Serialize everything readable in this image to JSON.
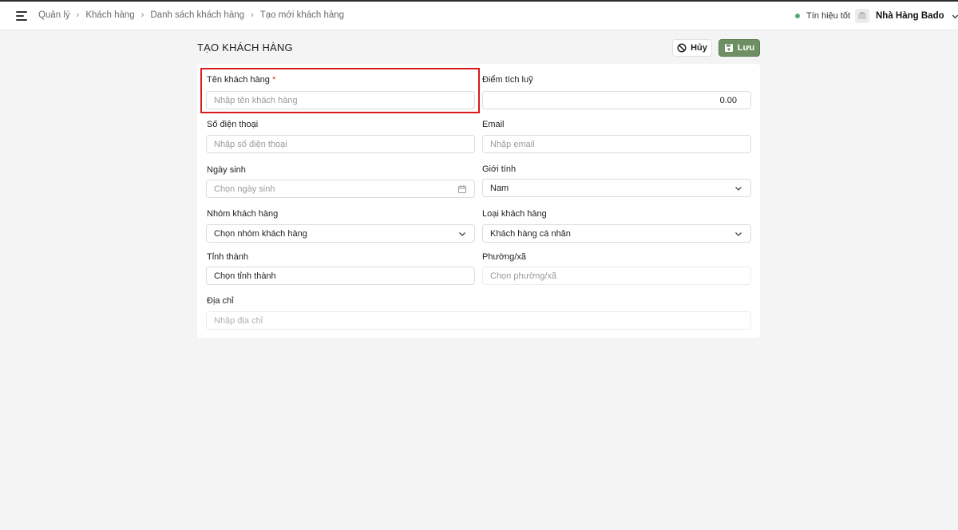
{
  "breadcrumb": [
    "Quản lý",
    "Khách hàng",
    "Danh sách khách hàng",
    "Tạo mới khách hàng"
  ],
  "status": {
    "text": "Tín hiệu tốt",
    "color": "#4caf7a"
  },
  "store": {
    "name": "Nhà Hàng Bado",
    "icon": "store-logo-icon"
  },
  "page": {
    "title": "TẠO KHÁCH HÀNG"
  },
  "actions": {
    "cancel_label": "Hủy",
    "save_label": "Lưu",
    "save_color": "#6e8f63"
  },
  "form": {
    "customer_name": {
      "label": "Tên khách hàng",
      "required_mark": "*",
      "placeholder": "Nhập tên khách hàng"
    },
    "points": {
      "label": "Điểm tích luỹ",
      "value": "0.00"
    },
    "phone": {
      "label": "Số điện thoại",
      "placeholder": "Nhập số điện thoại"
    },
    "email": {
      "label": "Email",
      "placeholder": "Nhập email"
    },
    "birthday": {
      "label": "Ngày sinh",
      "placeholder": "Chọn ngày sinh"
    },
    "gender": {
      "label": "Giới tính",
      "value": "Nam"
    },
    "group": {
      "label": "Nhóm khách hàng",
      "value": "Chọn nhóm khách hàng"
    },
    "type": {
      "label": "Loại khách hàng",
      "value": "Khách hàng cá nhân"
    },
    "province": {
      "label": "Tỉnh thành",
      "value": "Chọn tỉnh thành"
    },
    "ward": {
      "label": "Phường/xã",
      "placeholder": "Chọn phường/xã"
    },
    "address": {
      "label": "Địa chỉ",
      "placeholder": "Nhập địa chỉ"
    }
  },
  "highlight_color": "#d71a1a"
}
